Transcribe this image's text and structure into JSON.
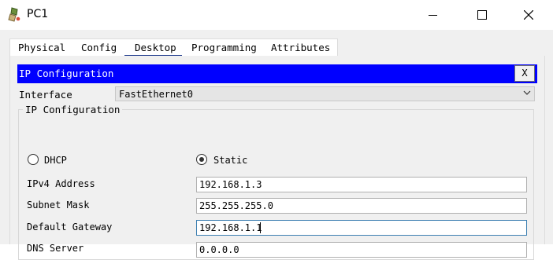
{
  "window": {
    "title": "PC1"
  },
  "tabs": [
    {
      "label": "Physical"
    },
    {
      "label": "Config"
    },
    {
      "label": "Desktop",
      "active": true
    },
    {
      "label": "Programming"
    },
    {
      "label": "Attributes"
    }
  ],
  "panel": {
    "title": "IP Configuration",
    "close_label": "X",
    "title_bar_color": "#0000ff"
  },
  "interface": {
    "label": "Interface",
    "value": "FastEthernet0"
  },
  "ip_config": {
    "group_title": "IP Configuration",
    "dhcp_label": "DHCP",
    "static_label": "Static",
    "selected_mode": "Static",
    "fields": {
      "ipv4": {
        "label": "IPv4 Address",
        "value": "192.168.1.3"
      },
      "mask": {
        "label": "Subnet Mask",
        "value": "255.255.255.0"
      },
      "gateway": {
        "label": "Default Gateway",
        "value": "192.168.1.1"
      },
      "dns": {
        "label": "DNS Server",
        "value": "0.0.0.0"
      }
    }
  }
}
